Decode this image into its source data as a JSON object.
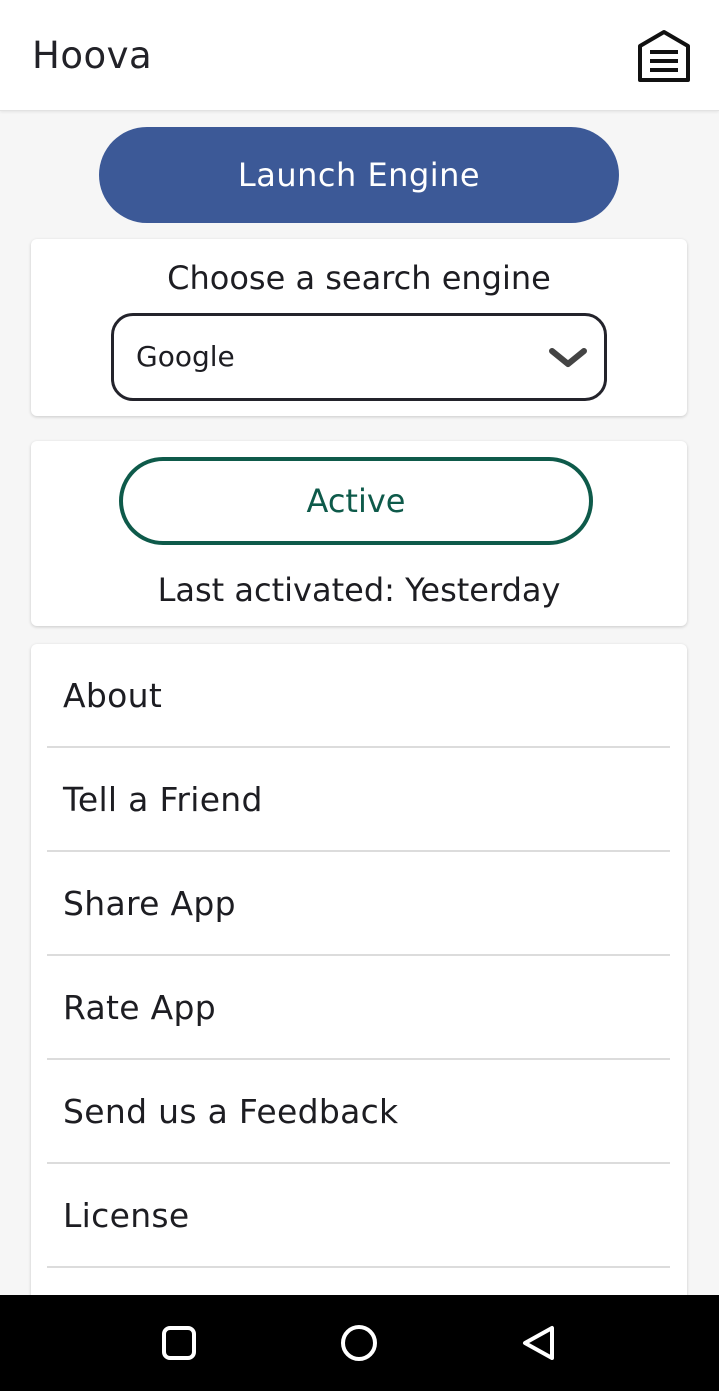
{
  "app_bar": {
    "title": "Hoova",
    "menu_icon": "hamburger-house-icon"
  },
  "launch": {
    "label": "Launch Engine",
    "color": "#3c5997"
  },
  "engine": {
    "heading": "Choose a search engine",
    "selected": "Google",
    "dropdown_icon": "chevron-down-icon"
  },
  "status": {
    "label": "Active",
    "last_activated": "Last activated: Yesterday",
    "color": "#0e5a4a"
  },
  "menu": {
    "items": [
      {
        "label": "About"
      },
      {
        "label": "Tell a Friend"
      },
      {
        "label": "Share App"
      },
      {
        "label": "Rate App"
      },
      {
        "label": "Send us a Feedback"
      },
      {
        "label": "License"
      }
    ]
  },
  "system_nav": {
    "recents_icon": "recents-square-icon",
    "home_icon": "home-circle-icon",
    "back_icon": "back-triangle-icon"
  }
}
